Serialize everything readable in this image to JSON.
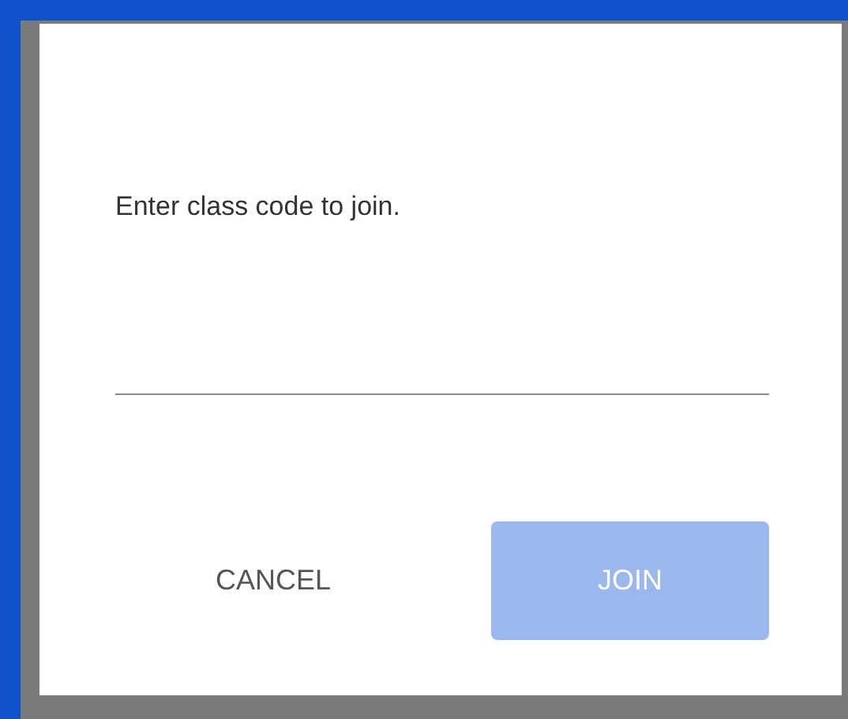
{
  "dialog": {
    "prompt": "Enter class code to join.",
    "buttons": [
      {
        "label": "CANCEL",
        "kind": "text",
        "disabled": false
      },
      {
        "label": "JOIN",
        "kind": "filled",
        "disabled": true
      }
    ]
  }
}
